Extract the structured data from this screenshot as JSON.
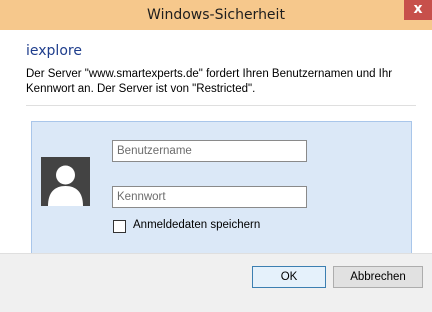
{
  "window": {
    "title": "Windows-Sicherheit",
    "close_label": "x"
  },
  "dialog": {
    "app_name": "iexplore",
    "message": "Der Server \"www.smartexperts.de\" fordert Ihren Benutzernamen und Ihr Kennwort an. Der Server ist von \"Restricted\"."
  },
  "credentials": {
    "username_placeholder": "Benutzername",
    "username_value": "",
    "password_placeholder": "Kennwort",
    "password_value": "",
    "remember_label": "Anmeldedaten speichern",
    "remember_checked": false
  },
  "buttons": {
    "ok_label": "OK",
    "cancel_label": "Abbrechen"
  },
  "icons": {
    "avatar": "user-silhouette-icon",
    "close": "close-icon"
  },
  "colors": {
    "titlebar": "#f6c88c",
    "close_button": "#c7504b",
    "app_name": "#1e3d8c",
    "cred_panel": "#dbe8f7",
    "cred_panel_border": "#a9c6ea"
  }
}
